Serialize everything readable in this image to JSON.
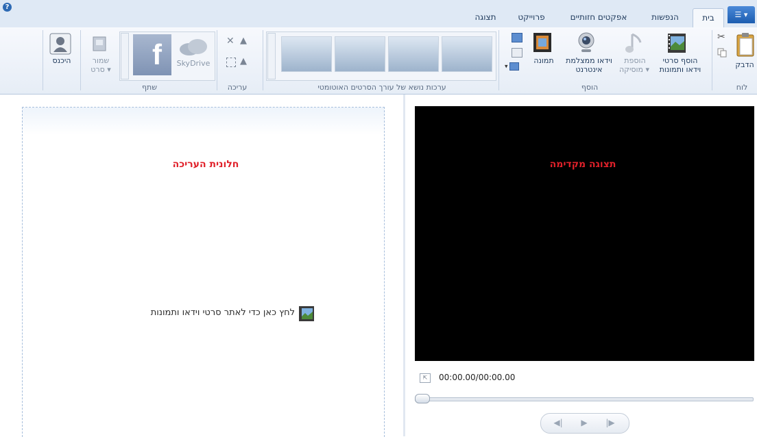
{
  "tabs": [
    "בית",
    "הנפשות",
    "אפקטים חזותיים",
    "פרוייקט",
    "תצוגה"
  ],
  "app_menu_label": "▾",
  "help_label": "?",
  "ribbon": {
    "clipboard": {
      "paste": "הדבק",
      "group": "לוח"
    },
    "add": {
      "add_videos_line1": "הוסף סרטי",
      "add_videos_line2": "וידאו ותמונות",
      "add_music_line1": "הוספת",
      "add_music_line2": "מוסיקה ▾",
      "webcam_line1": "וידאו ממצלמת",
      "webcam_line2": "אינטרנט",
      "snapshot": "תמונה",
      "group": "הוסף"
    },
    "themes": {
      "group": "ערכות נושא של עורך הסרטים האוטומטי"
    },
    "editing": {
      "group": "עריכה"
    },
    "share": {
      "skydrive": "SkyDrive",
      "save_line1": "שמור",
      "save_line2": "סרט ▾",
      "group": "שתף"
    },
    "signin": "היכנס"
  },
  "editing_pane_label": "חלונית העריכה",
  "browse_prompt": "לחץ כאן כדי לאתר סרטי וידאו ותמונות",
  "preview_label": "תצוגה מקדימה",
  "timecode": "00:00.00/00:00.00"
}
